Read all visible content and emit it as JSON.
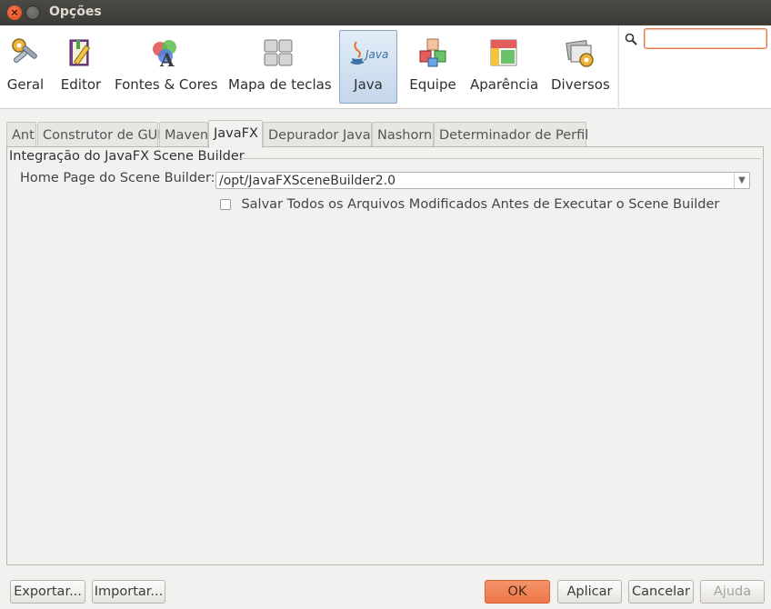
{
  "window": {
    "title": "Opções"
  },
  "toolbar": {
    "items": [
      {
        "label": "Geral",
        "icon": "wrench-gear-icon"
      },
      {
        "label": "Editor",
        "icon": "notebook-pencil-icon"
      },
      {
        "label": "Fontes & Cores",
        "icon": "font-colors-icon"
      },
      {
        "label": "Mapa de teclas",
        "icon": "keyboard-keys-icon"
      },
      {
        "label": "Java",
        "icon": "java-icon",
        "java_text": "Java",
        "selected": true
      },
      {
        "label": "Equipe",
        "icon": "team-cubes-icon"
      },
      {
        "label": "Aparência",
        "icon": "appearance-layout-icon"
      },
      {
        "label": "Diversos",
        "icon": "misc-photos-gear-icon"
      }
    ]
  },
  "search": {
    "value": "",
    "icon": "search-icon"
  },
  "tabs": [
    {
      "label": "Ant"
    },
    {
      "label": "Construtor de GUI"
    },
    {
      "label": "Maven"
    },
    {
      "label": "JavaFX",
      "active": true
    },
    {
      "label": "Depurador Java"
    },
    {
      "label": "Nashorn"
    },
    {
      "label": "Determinador de Perfil"
    }
  ],
  "panel": {
    "group_title": "Integração do JavaFX Scene Builder",
    "home_label": "Home Page do Scene Builder:",
    "home_value": "/opt/JavaFXSceneBuilder2.0",
    "save_all_label": "Salvar Todos os Arquivos Modificados Antes de Executar o Scene Builder",
    "save_all_checked": false
  },
  "buttons": {
    "export": "Exportar...",
    "import": "Importar...",
    "ok": "OK",
    "apply": "Aplicar",
    "cancel": "Cancelar",
    "help": "Ajuda"
  },
  "colors": {
    "accent": "#ef7b4b",
    "titlebar": "#3c3b37",
    "selected_tool": "#c4d6ea"
  }
}
